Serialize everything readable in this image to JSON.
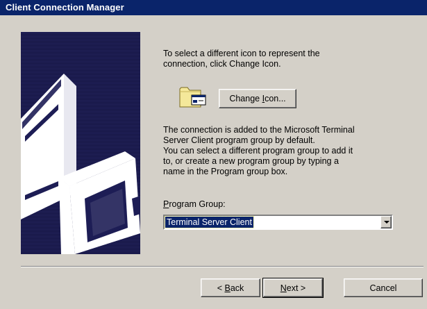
{
  "window": {
    "title": "Client Connection Manager"
  },
  "intro": {
    "line1": "To select a different icon to represent the",
    "line2": "connection, click Change Icon."
  },
  "change_icon": {
    "label_pre": "Change ",
    "label_accel": "I",
    "label_post": "con..."
  },
  "description": {
    "line1": "The connection is added to the Microsoft Terminal",
    "line2": "Server Client program group by default.",
    "line3": "You can select a different program group to add it",
    "line4": "to, or create a new program group by typing a",
    "line5": "name in the Program group box."
  },
  "program_group": {
    "label_accel": "P",
    "label_rest": "rogram Group:",
    "value": "Terminal Server Client"
  },
  "nav": {
    "back_prefix": "< ",
    "back_accel": "B",
    "back_rest": "ack",
    "next_accel": "N",
    "next_rest": "ext >",
    "cancel": "Cancel"
  },
  "icons": {
    "folder": "program-folder-icon",
    "art": "computer-server-illustration",
    "dropdown": "chevron-down-icon"
  }
}
